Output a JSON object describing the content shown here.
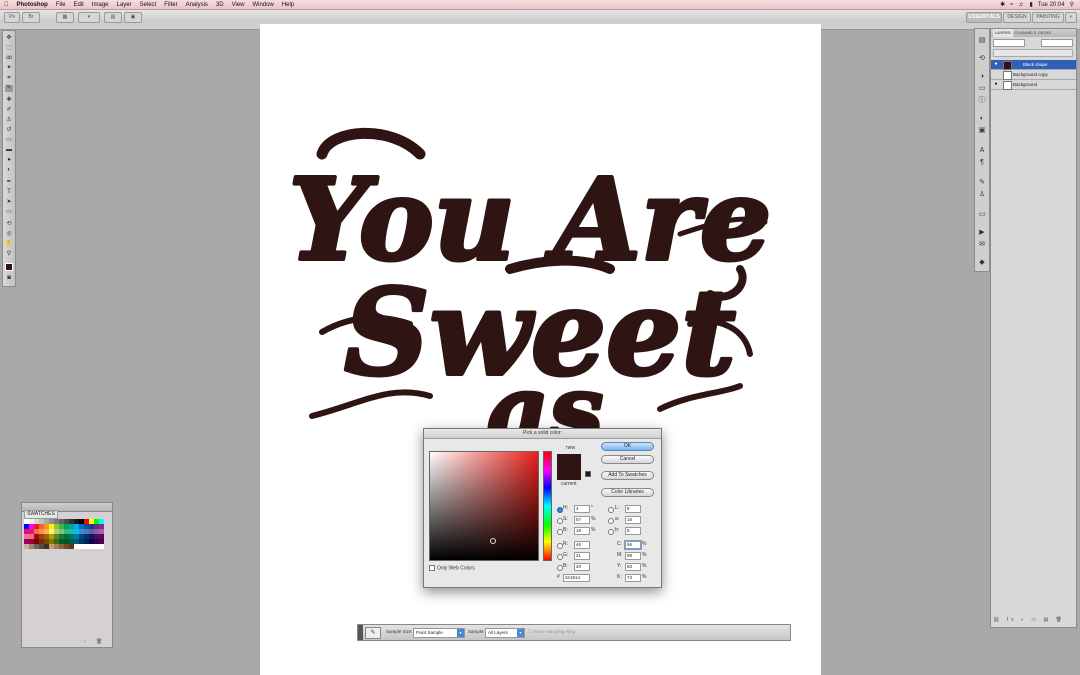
{
  "menubar": {
    "app_name": "Photoshop",
    "items": [
      "File",
      "Edit",
      "Image",
      "Layer",
      "Select",
      "Filter",
      "Analysis",
      "3D",
      "View",
      "Window",
      "Help"
    ],
    "clock": "Tue 20:04"
  },
  "optbar": {
    "workspace_labels": [
      "ESSENTIALS",
      "DESIGN",
      "PAINTING"
    ]
  },
  "swatches_panel": {
    "tab_label": "SWATCHES",
    "colors": [
      "#ffffff",
      "#f0f0f0",
      "#d8d8d8",
      "#c0c0c0",
      "#a8a8a8",
      "#909090",
      "#787878",
      "#606060",
      "#484848",
      "#303030",
      "#181818",
      "#000000",
      "#ff0000",
      "#ffff00",
      "#00ff00",
      "#00ffff",
      "#0000ff",
      "#ff00ff",
      "#ed1c24",
      "#f26522",
      "#f7941d",
      "#fff200",
      "#8dc63f",
      "#39b54a",
      "#00a651",
      "#00a99d",
      "#00aeef",
      "#0072bc",
      "#0054a6",
      "#2e3192",
      "#662d91",
      "#92278f",
      "#ec008c",
      "#ed145b",
      "#f26c4f",
      "#f68e56",
      "#fbaf5d",
      "#fff568",
      "#acd373",
      "#7cc576",
      "#3bb878",
      "#1abbb4",
      "#00bff3",
      "#438ccb",
      "#5574b9",
      "#605ca8",
      "#8560a8",
      "#a763a8",
      "#f06ea9",
      "#f26d7d",
      "#9e0b0f",
      "#a0410d",
      "#a36209",
      "#aba000",
      "#598527",
      "#197b30",
      "#007236",
      "#00746b",
      "#0076a3",
      "#004a80",
      "#003471",
      "#1b1464",
      "#440e62",
      "#630460",
      "#9e005d",
      "#9e0039",
      "#790000",
      "#7b2e00",
      "#7d4900",
      "#827b00",
      "#406618",
      "#005e20",
      "#005826",
      "#005952",
      "#005b7f",
      "#003663",
      "#002157",
      "#0d004c",
      "#32004b",
      "#4b0049",
      "#c7b299",
      "#998675",
      "#736357",
      "#534741",
      "#37302d",
      "#c69c6d",
      "#a67c52",
      "#8c6239",
      "#754c24",
      "#603913",
      "#ffffff",
      "#ffffff",
      "#ffffff",
      "#ffffff",
      "#ffffff",
      "#ffffff"
    ]
  },
  "layers_panel": {
    "tabs": [
      "LAYERS",
      "CHANNELS",
      "PATHS"
    ],
    "rows": [
      {
        "name": "Black shape",
        "selected": true
      },
      {
        "name": "Background copy",
        "selected": false
      },
      {
        "name": "Background",
        "selected": false
      }
    ]
  },
  "artwork": {
    "lines": [
      "You Are",
      "Sweet",
      "as"
    ],
    "ink_color": "#2e1514"
  },
  "color_picker": {
    "title": "Pick a solid color:",
    "ok_label": "OK",
    "cancel_label": "Cancel",
    "add_to_swatches_label": "Add To Swatches",
    "color_libraries_label": "Color Libraries",
    "new_label": "new",
    "current_label": "current",
    "new_color": "#2e1514",
    "current_color": "#2e1514",
    "only_web_colors_label": "Only Web Colors",
    "hsb": [
      {
        "label": "H:",
        "value": "4",
        "unit": "°"
      },
      {
        "label": "S:",
        "value": "57",
        "unit": "%"
      },
      {
        "label": "B:",
        "value": "18",
        "unit": "%"
      }
    ],
    "rgb": [
      {
        "label": "R:",
        "value": "46"
      },
      {
        "label": "G:",
        "value": "21"
      },
      {
        "label": "B:",
        "value": "20"
      }
    ],
    "lab": [
      {
        "label": "L:",
        "value": "9"
      },
      {
        "label": "a:",
        "value": "16"
      },
      {
        "label": "b:",
        "value": "5"
      }
    ],
    "cmyk": [
      {
        "label": "C:",
        "value": "56",
        "unit": "%"
      },
      {
        "label": "M:",
        "value": "89",
        "unit": "%"
      },
      {
        "label": "Y:",
        "value": "83",
        "unit": "%"
      },
      {
        "label": "K:",
        "value": "74",
        "unit": "%"
      }
    ],
    "hex_label": "#",
    "hex_value": "2e1514"
  },
  "eyedropper_bar": {
    "sample_size_label": "Sample Size:",
    "sample_size_value": "Point Sample",
    "sample_label": "Sample:",
    "sample_value": "All Layers",
    "show_ring_label": "Show Sampling Ring"
  }
}
